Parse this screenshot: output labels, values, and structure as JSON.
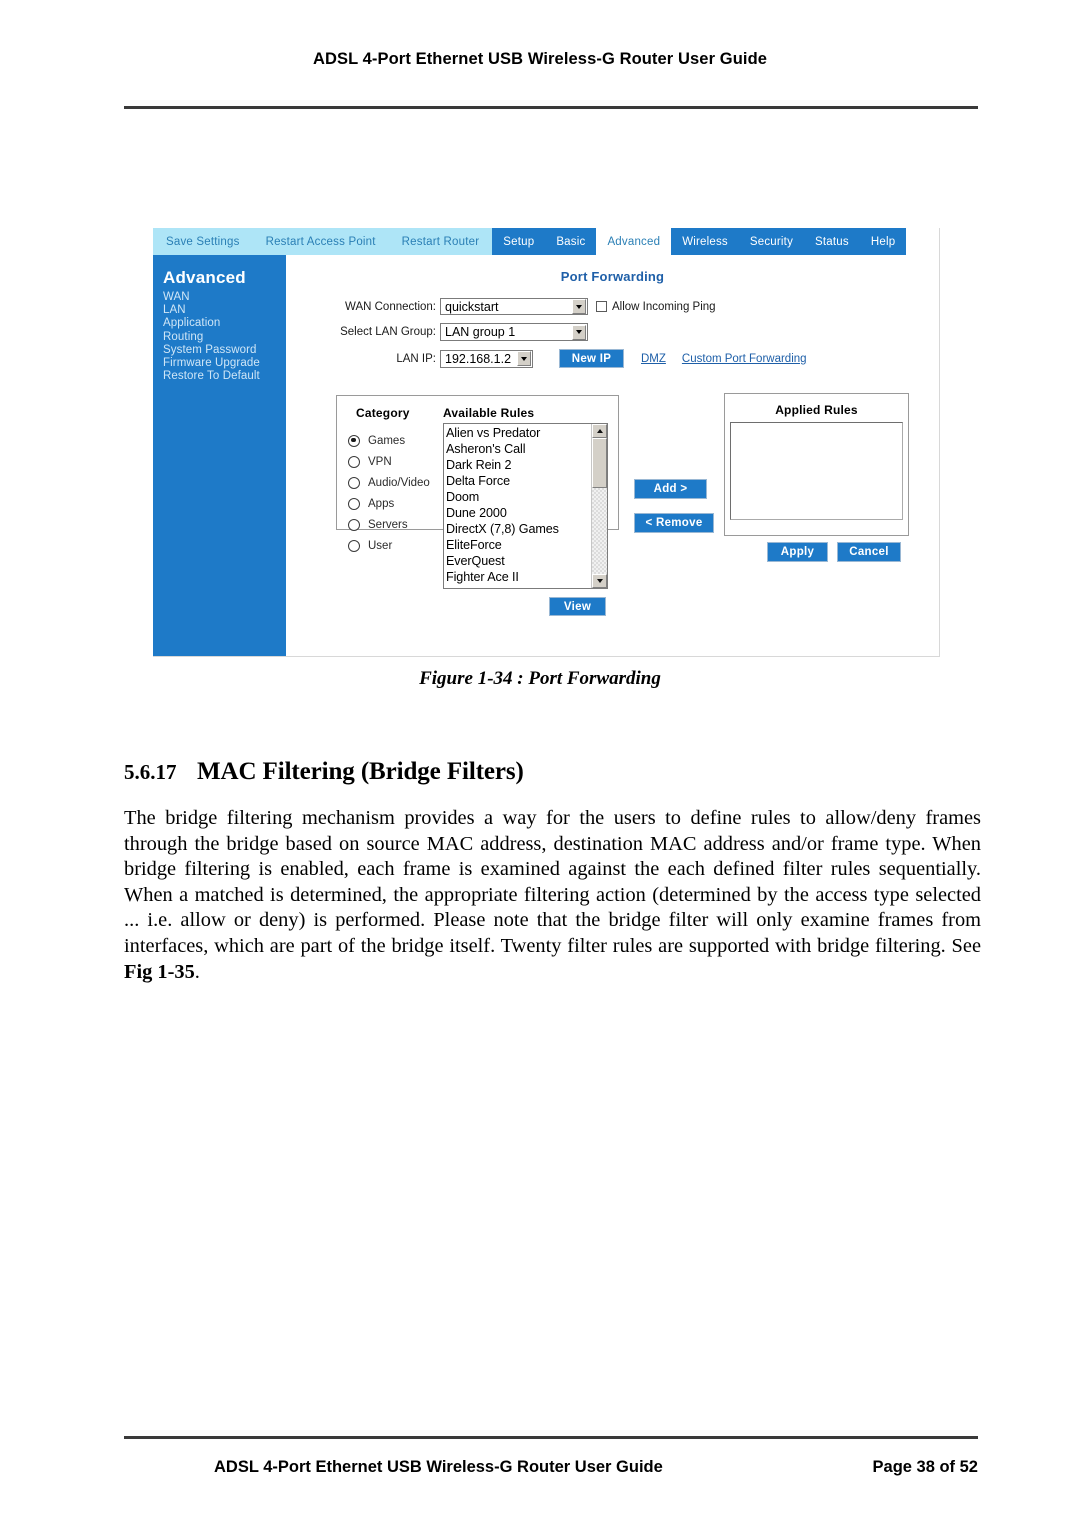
{
  "document": {
    "running_head": "ADSL 4-Port Ethernet USB Wireless-G Router User Guide",
    "footer_title": "ADSL 4-Port Ethernet USB Wireless-G Router User Guide",
    "footer_page": "Page 38 of 52"
  },
  "figure": {
    "caption": "Figure 1-34 : Port Forwarding"
  },
  "router_ui": {
    "nav_left": [
      {
        "label": "Save Settings"
      },
      {
        "label": "Restart Access Point"
      },
      {
        "label": "Restart Router"
      }
    ],
    "nav_tabs": [
      {
        "label": "Setup",
        "active": false
      },
      {
        "label": "Basic",
        "active": false
      },
      {
        "label": "Advanced",
        "active": true
      },
      {
        "label": "Wireless",
        "active": false
      },
      {
        "label": "Security",
        "active": false
      },
      {
        "label": "Status",
        "active": false
      },
      {
        "label": "Help",
        "active": false
      }
    ],
    "sidebar": {
      "title": "Advanced",
      "items": [
        {
          "label": "WAN"
        },
        {
          "label": "LAN"
        },
        {
          "label": "Application"
        },
        {
          "label": "Routing"
        },
        {
          "label": "System Password"
        },
        {
          "label": "Firmware Upgrade"
        },
        {
          "label": "Restore To Default"
        }
      ]
    },
    "page_title": "Port Forwarding",
    "form": {
      "wan_connection_label": "WAN Connection:",
      "wan_connection_value": "quickstart",
      "allow_incoming_ping_label": "Allow Incoming Ping",
      "allow_incoming_ping_checked": false,
      "lan_group_label": "Select LAN Group:",
      "lan_group_value": "LAN group 1",
      "lan_ip_label": "LAN IP:",
      "lan_ip_value": "192.168.1.2",
      "new_ip_button": "New IP",
      "dmz_link": "DMZ",
      "custom_port_forwarding_link": "Custom Port Forwarding"
    },
    "rules_panel": {
      "category_header": "Category",
      "available_rules_header": "Available Rules",
      "applied_rules_header": "Applied Rules",
      "categories": [
        {
          "label": "Games",
          "selected": true
        },
        {
          "label": "VPN",
          "selected": false
        },
        {
          "label": "Audio/Video",
          "selected": false
        },
        {
          "label": "Apps",
          "selected": false
        },
        {
          "label": "Servers",
          "selected": false
        },
        {
          "label": "User",
          "selected": false
        }
      ],
      "available_rules": [
        "Alien vs Predator",
        "Asheron's Call",
        "Dark Rein 2",
        "Delta Force",
        "Doom",
        "Dune 2000",
        "DirectX (7,8) Games",
        "EliteForce",
        "EverQuest",
        "Fighter Ace II"
      ],
      "applied_rules": [],
      "add_button": "Add >",
      "remove_button": "< Remove",
      "view_button": "View"
    },
    "actions": {
      "apply_button": "Apply",
      "cancel_button": "Cancel"
    },
    "colors": {
      "nav_blue": "#1e7ac8",
      "nav_light_cyan": "#aee5f7",
      "sidebar_blue": "#1e7ac8",
      "title_blue": "#1e5fa8",
      "link_blue": "#1e5fa8"
    }
  },
  "section": {
    "number": "5.6.17",
    "heading": "MAC Filtering (Bridge Filters)",
    "paragraph_part1": "The bridge filtering mechanism provides a way for the users to define rules to allow/deny frames through the bridge based on source MAC address, destination MAC address and/or frame type. When bridge filtering is enabled, each frame is examined against the each defined filter rules sequentially. When a matched is determined, the appropriate filtering action (determined by the access type selected ... i.e. allow or deny) is performed. Please note that the bridge filter will only examine frames from interfaces, which are part of the bridge itself. Twenty filter rules are supported with bridge filtering. See ",
    "paragraph_ref": "Fig 1-35",
    "paragraph_part2": "."
  }
}
